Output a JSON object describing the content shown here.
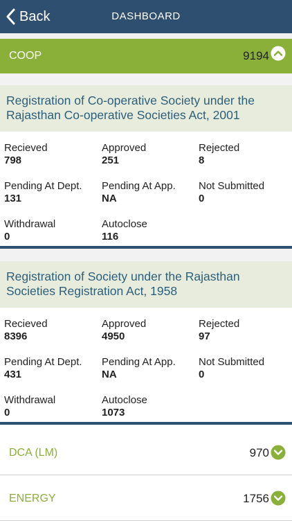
{
  "header": {
    "back_label": "Back",
    "title": "DASHBOARD"
  },
  "colors": {
    "header_bg": "#2e4f70",
    "accent_green": "#8ab039",
    "card_title": "#2c5f7c"
  },
  "groups": [
    {
      "name": "COOP",
      "count": "9194",
      "expanded": true,
      "toggle_icon": "chevron-up-icon"
    }
  ],
  "services": [
    {
      "title": "Registration of Co-operative Society under the Rajasthan Co-operative Societies Act, 2001",
      "stats": [
        {
          "label": "Recieved",
          "value": "798"
        },
        {
          "label": "Approved",
          "value": "251"
        },
        {
          "label": "Rejected",
          "value": "8"
        },
        {
          "label": "Pending At Dept.",
          "value": "131"
        },
        {
          "label": "Pending At App.",
          "value": "NA"
        },
        {
          "label": "Not Submitted",
          "value": "0"
        },
        {
          "label": "Withdrawal",
          "value": "0"
        },
        {
          "label": "Autoclose",
          "value": "116"
        }
      ]
    },
    {
      "title": "Registration of Society under the Rajasthan Societies Registration Act, 1958",
      "stats": [
        {
          "label": "Recieved",
          "value": "8396"
        },
        {
          "label": "Approved",
          "value": "4950"
        },
        {
          "label": "Rejected",
          "value": "97"
        },
        {
          "label": "Pending At Dept.",
          "value": "431"
        },
        {
          "label": "Pending At App.",
          "value": "NA"
        },
        {
          "label": "Not Submitted",
          "value": "0"
        },
        {
          "label": "Withdrawal",
          "value": "0"
        },
        {
          "label": "Autoclose",
          "value": "1073"
        }
      ]
    }
  ],
  "departments": [
    {
      "name": "DCA (LM)",
      "count": "970",
      "expanded": false,
      "toggle_icon": "chevron-down-icon"
    },
    {
      "name": "ENERGY",
      "count": "1756",
      "expanded": false,
      "toggle_icon": "chevron-down-icon"
    }
  ]
}
